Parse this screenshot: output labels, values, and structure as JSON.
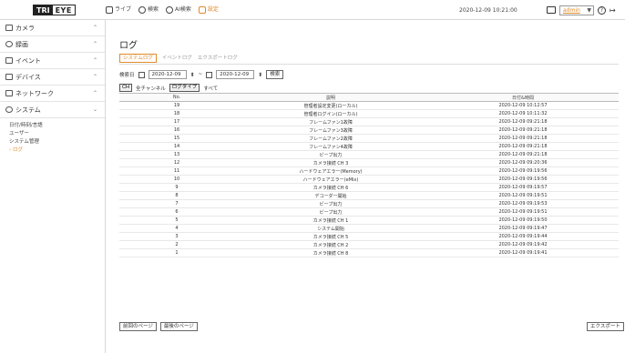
{
  "app": {
    "logo_a": "TRI",
    "logo_b": "EYE"
  },
  "topnav": [
    {
      "icon": "live-view-icon",
      "label": "ライブ"
    },
    {
      "icon": "search-icon",
      "label": "検索"
    },
    {
      "icon": "ai-search-icon",
      "label": "AI検索"
    },
    {
      "icon": "settings-icon",
      "label": "設定"
    }
  ],
  "datetime": "2020-12-09 10:21:00",
  "user": {
    "name": "admin",
    "chevron": "▼"
  },
  "help_glyph": "?",
  "logout_glyph": "↦",
  "sidebar": {
    "items": [
      {
        "label": "カメラ",
        "icon": "camera-icon",
        "chev": "⌃"
      },
      {
        "label": "録画",
        "icon": "record-icon",
        "chev": "⌃"
      },
      {
        "label": "イベント",
        "icon": "event-icon",
        "chev": "⌃"
      },
      {
        "label": "デバイス",
        "icon": "device-icon",
        "chev": "⌃"
      },
      {
        "label": "ネットワーク",
        "icon": "network-icon",
        "chev": "⌃"
      },
      {
        "label": "システム",
        "icon": "system-icon",
        "chev": "⌄"
      }
    ],
    "sub": [
      {
        "label": "日付/時刻/言語"
      },
      {
        "label": "ユーザー"
      },
      {
        "label": "システム管理"
      },
      {
        "label": "ログ"
      }
    ]
  },
  "page": {
    "title": "ログ",
    "tabs": [
      "システムログ",
      "イベントログ",
      "エクスポートログ"
    ],
    "search": {
      "label": "検索日",
      "from": "2020-12-09",
      "sep": "~",
      "to": "2020-12-09",
      "button": "検索"
    },
    "filter": {
      "ch_button": "CH",
      "all_channels": "全チャンネル",
      "log_type_button": "ログタイプ",
      "all": "すべて"
    },
    "columns": [
      "No.",
      "説明",
      "日付&時間"
    ],
    "rows": [
      {
        "no": "19",
        "desc": "管理者設定変更(ローカル)",
        "dt": "2020-12-09 10:12:57"
      },
      {
        "no": "18",
        "desc": "管理者ログイン(ローカル)",
        "dt": "2020-12-09 10:11:32"
      },
      {
        "no": "17",
        "desc": "フレームファン1故障",
        "dt": "2020-12-09 09:21:18"
      },
      {
        "no": "16",
        "desc": "フレームファン3故障",
        "dt": "2020-12-09 09:21:18"
      },
      {
        "no": "15",
        "desc": "フレームファン2故障",
        "dt": "2020-12-09 09:21:18"
      },
      {
        "no": "14",
        "desc": "フレームファン4故障",
        "dt": "2020-12-09 09:21:18"
      },
      {
        "no": "13",
        "desc": "ビープ出力",
        "dt": "2020-12-09 09:21:18"
      },
      {
        "no": "12",
        "desc": "カメラ接続 CH 3",
        "dt": "2020-12-09 09:20:36"
      },
      {
        "no": "11",
        "desc": "ハードウェアエラー(Memory)",
        "dt": "2020-12-09 09:19:56"
      },
      {
        "no": "10",
        "desc": "ハードウェアエラー(eMix)",
        "dt": "2020-12-09 09:19:56"
      },
      {
        "no": "9",
        "desc": "カメラ接続 CH 6",
        "dt": "2020-12-09 09:19:57"
      },
      {
        "no": "8",
        "desc": "デコーダー開始",
        "dt": "2020-12-09 09:19:51"
      },
      {
        "no": "7",
        "desc": "ビープ出力",
        "dt": "2020-12-09 09:19:53"
      },
      {
        "no": "6",
        "desc": "ビープ出力",
        "dt": "2020-12-09 09:19:51"
      },
      {
        "no": "5",
        "desc": "カメラ接続 CH 1",
        "dt": "2020-12-09 09:19:50"
      },
      {
        "no": "4",
        "desc": "システム開始",
        "dt": "2020-12-09 09:19:47"
      },
      {
        "no": "3",
        "desc": "カメラ接続 CH 5",
        "dt": "2020-12-09 09:19:44"
      },
      {
        "no": "2",
        "desc": "カメラ接続 CH 2",
        "dt": "2020-12-09 09:19:42"
      },
      {
        "no": "1",
        "desc": "カメラ接続 CH 8",
        "dt": "2020-12-09 09:19:41"
      }
    ],
    "prev_page": "前回のページ",
    "next_page": "最後のページ",
    "export": "エクスポート"
  }
}
